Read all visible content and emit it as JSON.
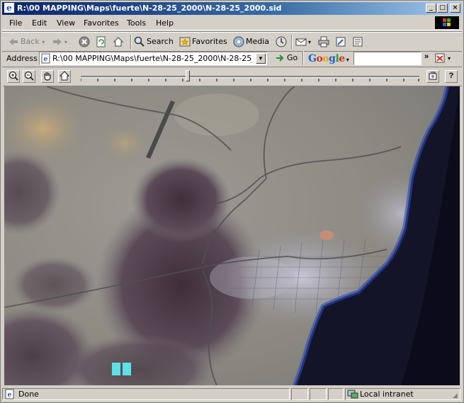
{
  "window": {
    "title": "R:\\00 MAPPING\\Maps\\fuerte\\N-28-25_2000\\N-28-25_2000.sid",
    "controls": [
      "_",
      "□",
      "×"
    ]
  },
  "menu": [
    "File",
    "Edit",
    "View",
    "Favorites",
    "Tools",
    "Help"
  ],
  "toolbar": {
    "back": "Back",
    "search": "Search",
    "favorites": "Favorites",
    "media": "Media"
  },
  "address": {
    "label": "Address",
    "value": "R:\\00 MAPPING\\Maps\\fuerte\\N-28-25_2000\\N-28-25_2000.sid",
    "go": "Go",
    "google": "Google",
    "google_chars": [
      "G",
      "o",
      "o",
      "g",
      "l",
      "e"
    ],
    "google_colors": [
      "#1a5fd1",
      "#d62d20",
      "#e8a400",
      "#1a5fd1",
      "#2e9b3a",
      "#d62d20"
    ],
    "search_value": ""
  },
  "viewer": {
    "zoom_in": "zoom-in",
    "zoom_out": "zoom-out",
    "pan": "pan",
    "home": "home",
    "help": "?"
  },
  "status": {
    "text": "Done",
    "zone": "Local intranet"
  }
}
